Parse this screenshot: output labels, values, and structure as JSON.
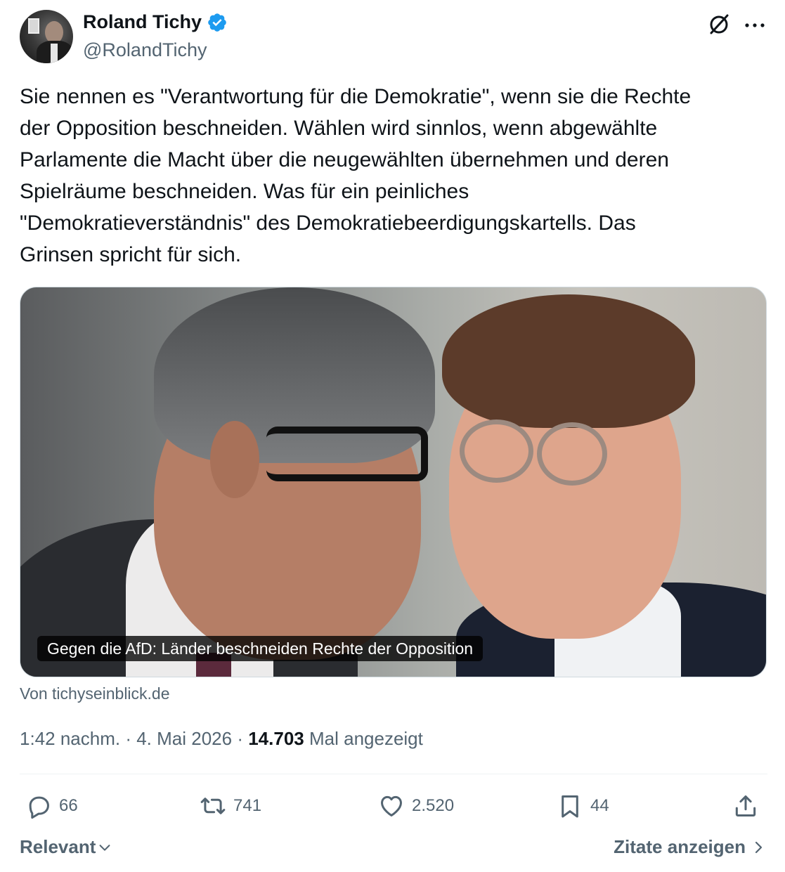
{
  "author": {
    "display_name": "Roland Tichy",
    "handle": "@RolandTichy",
    "verified_color": "#1d9bf0"
  },
  "icons": {
    "verified": "verified-badge-icon",
    "grok": "grok-icon",
    "more": "more-icon",
    "reply": "reply-icon",
    "repost": "repost-icon",
    "like": "heart-icon",
    "bookmark": "bookmark-icon",
    "share": "share-icon"
  },
  "tweet": {
    "text": "Sie nennen es \"Verantwortung für die Demokratie\", wenn sie die Rechte\nder Opposition beschneiden. Wählen wird sinnlos, wenn abgewählte\nParlamente die Macht über die neugewählten übernehmen und deren\nSpielräume beschneiden. Was für ein peinliches\n\"Demokratieverständnis\" des Demokratiebeerdigungskartells. Das\nGrinsen spricht für sich."
  },
  "media": {
    "caption": "Gegen die AfD: Länder beschneiden Rechte der Opposition",
    "source": "Von tichyseinblick.de"
  },
  "meta": {
    "time": "1:42 nachm.",
    "date": "4. Mai 2026",
    "views_count": "14.703",
    "views_label": "Mal angezeigt"
  },
  "stats": {
    "replies": "66",
    "reposts": "741",
    "likes": "2.520",
    "bookmarks": "44"
  },
  "footer": {
    "sort_label": "Relevant",
    "quotes_label": "Zitate anzeigen"
  }
}
